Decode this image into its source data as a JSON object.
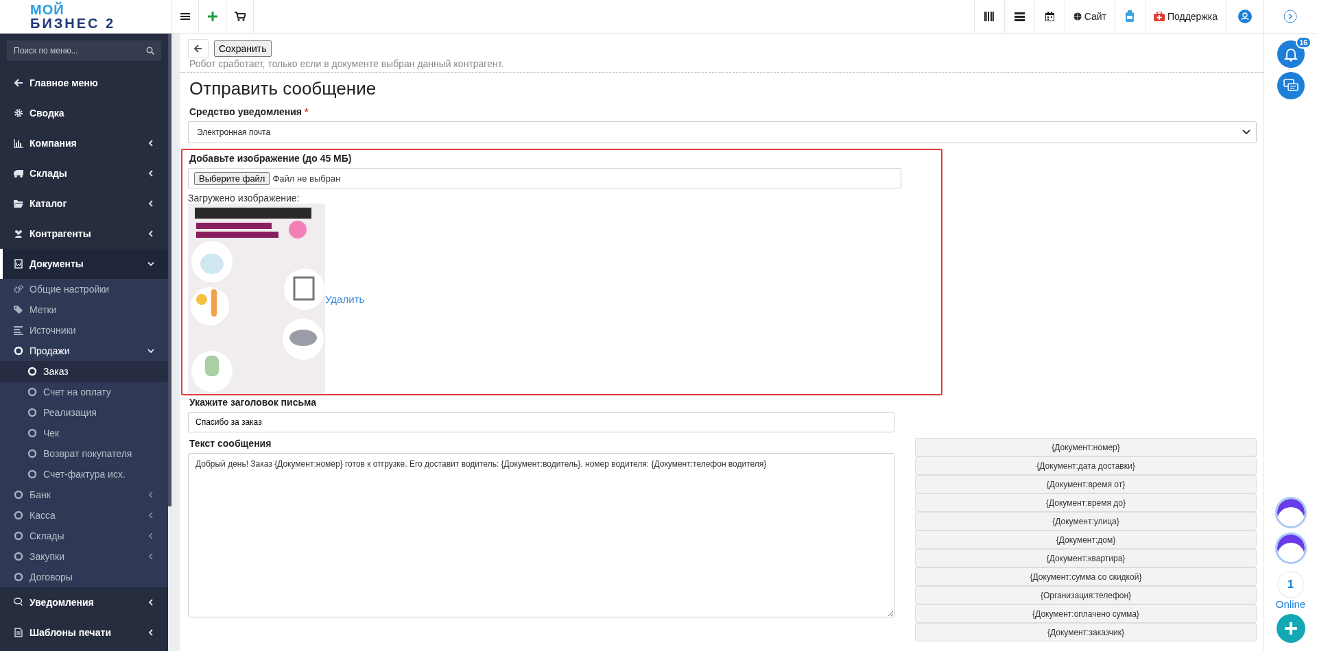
{
  "topbar": {
    "logo_top": "МОЙ",
    "logo_bottom": "БИЗНЕС 2",
    "site_link": "Сайт",
    "support_link": "Поддержка"
  },
  "sidebar": {
    "search": {
      "placeholder": "Поиск по меню..."
    },
    "items": [
      {
        "label": "Главное меню",
        "selected": false
      },
      {
        "label": "Сводка",
        "selected": false
      },
      {
        "label": "Компания",
        "selected": false,
        "expanded": false
      },
      {
        "label": "Склады",
        "selected": false,
        "expanded": false
      },
      {
        "label": "Каталог",
        "selected": false,
        "expanded": false
      },
      {
        "label": "Контрагенты",
        "selected": false,
        "expanded": false
      },
      {
        "label": "Документы",
        "selected": false,
        "expanded": true,
        "children": [
          {
            "label": "Общие настройки",
            "selected": false
          },
          {
            "label": "Метки",
            "selected": false
          },
          {
            "label": "Источники",
            "selected": false
          },
          {
            "label": "Продажи",
            "selected": false,
            "expanded": true,
            "children": [
              {
                "label": "Заказ",
                "selected": true
              },
              {
                "label": "Счет на оплату",
                "selected": false
              },
              {
                "label": "Реализация",
                "selected": false
              },
              {
                "label": "Чек",
                "selected": false
              },
              {
                "label": "Возврат покупателя",
                "selected": false
              },
              {
                "label": "Счет-фактура исх.",
                "selected": false
              }
            ]
          },
          {
            "label": "Банк",
            "selected": false,
            "expanded": false
          },
          {
            "label": "Касса",
            "selected": false,
            "expanded": false
          },
          {
            "label": "Склады",
            "selected": false,
            "expanded": false
          },
          {
            "label": "Закупки",
            "selected": false,
            "expanded": false
          },
          {
            "label": "Договоры",
            "selected": false
          }
        ]
      },
      {
        "label": "Уведомления",
        "selected": false,
        "expanded": false
      },
      {
        "label": "Шаблоны печати",
        "selected": false,
        "expanded": false
      }
    ]
  },
  "toolbar": {
    "save_button": "Сохранить",
    "note": "Робот сработает, только если в документе выбран данный контрагент."
  },
  "form": {
    "title": "Отправить сообщение",
    "channel": {
      "label": "Средство уведомления",
      "required_mark": "*",
      "value": "Электронная почта"
    },
    "image": {
      "label": "Добавьте изображение (до 45 МБ)",
      "file_button": "Выберите файл",
      "file_status": "Файл не выбран",
      "uploaded_label": "Загружено изображение:",
      "delete_link": "Удалить"
    },
    "subject": {
      "label": "Укажите заголовок письма",
      "value": "Спасибо за заказ"
    },
    "message": {
      "label": "Текст сообщения",
      "value": "Добрый день! Заказ {Документ:номер} готов к отгрузке. Его доставит водитель: {Документ:водитель}, номер водителя: {Документ:телефон водителя}"
    },
    "variables": [
      "{Документ:номер}",
      "{Документ:дата доставки}",
      "{Документ:время от}",
      "{Документ:время до}",
      "{Документ:улица}",
      "{Документ:дом}",
      "{Документ:квартира}",
      "{Документ:сумма со скидкой}",
      "{Организация:телефон}",
      "{Документ:оплачено сумма}",
      "{Документ:заказчик}"
    ]
  },
  "rail": {
    "notifications_badge": "16",
    "online_count": "1",
    "online_label": "Online"
  }
}
